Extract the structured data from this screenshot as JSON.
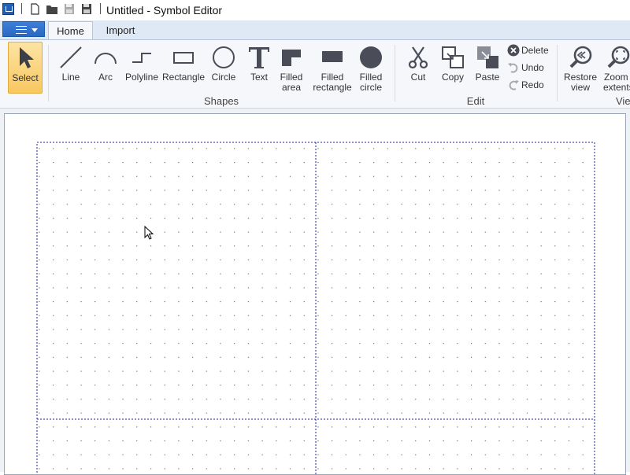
{
  "window": {
    "title": "Untitled - Symbol Editor"
  },
  "quick_access": [
    "new-file-icon",
    "open-folder-icon",
    "save-icon",
    "save-as-icon"
  ],
  "tabs": [
    {
      "label": "Home",
      "active": true
    },
    {
      "label": "Import",
      "active": false
    }
  ],
  "ribbon": {
    "select": {
      "label": "Select",
      "icon": "cursor-arrow-icon"
    },
    "shapes": {
      "group_label": "Shapes",
      "items": [
        {
          "label": "Line",
          "icon": "line-icon"
        },
        {
          "label": "Arc",
          "icon": "arc-icon"
        },
        {
          "label": "Polyline",
          "icon": "polyline-icon"
        },
        {
          "label": "Rectangle",
          "icon": "rectangle-icon"
        },
        {
          "label": "Circle",
          "icon": "circle-icon"
        },
        {
          "label": "Text",
          "icon": "text-icon"
        },
        {
          "label_line1": "Filled",
          "label_line2": "area",
          "icon": "filled-area-icon"
        },
        {
          "label_line1": "Filled",
          "label_line2": "rectangle",
          "icon": "filled-rectangle-icon"
        },
        {
          "label_line1": "Filled",
          "label_line2": "circle",
          "icon": "filled-circle-icon"
        }
      ]
    },
    "edit": {
      "group_label": "Edit",
      "cut": "Cut",
      "copy": "Copy",
      "paste": "Paste",
      "delete": "Delete",
      "undo": "Undo",
      "redo": "Redo"
    },
    "view": {
      "group_label": "View",
      "restore_line1": "Restore",
      "restore_line2": "view",
      "zoom_line1": "Zoom",
      "zoom_line2": "extents"
    }
  },
  "colors": {
    "accent": "#2a68c2",
    "select_highlight": "#f8c760",
    "page_border": "#2222aa",
    "grid_dot": "#333333",
    "icon": "#4a4d57"
  }
}
